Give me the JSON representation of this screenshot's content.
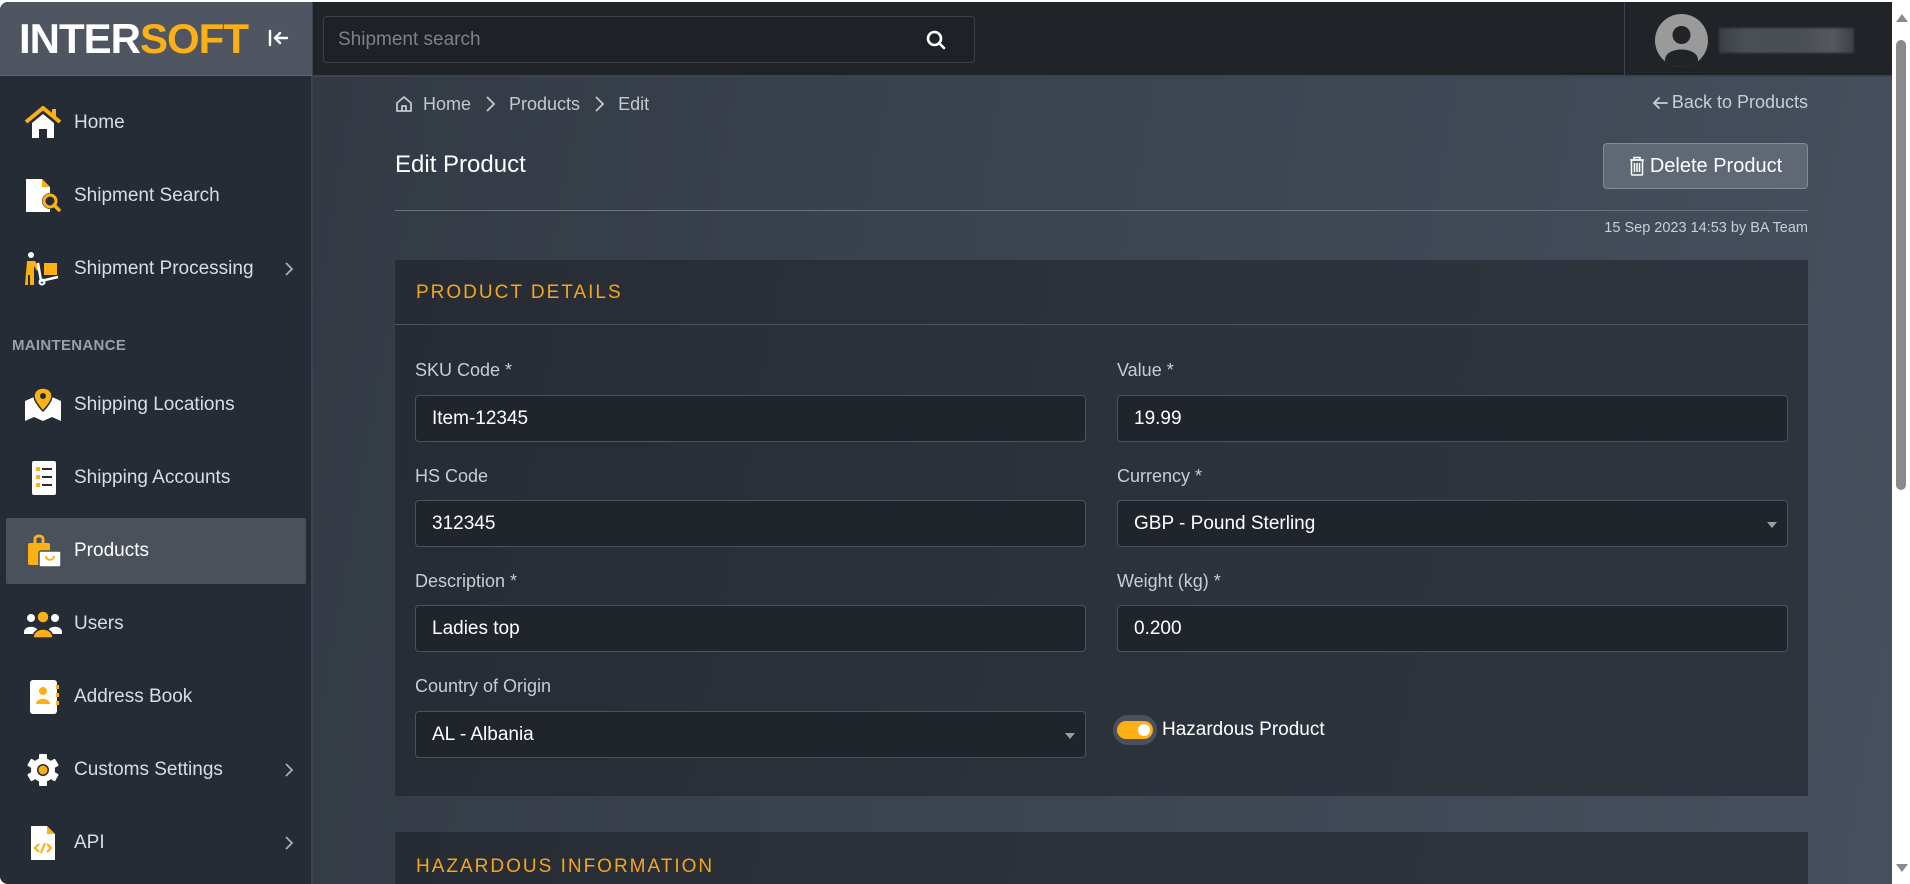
{
  "brand": {
    "logo_part1": "INTER",
    "logo_part2": "SOFT",
    "accent_color": "#fbb116",
    "collapse_icon": "collapse-sidebar-icon"
  },
  "topbar": {
    "search_placeholder": "Shipment search",
    "search_value": "",
    "search_icon": "search-icon",
    "avatar_icon": "user-avatar-icon"
  },
  "sidebar": {
    "items": [
      {
        "label": "Home",
        "icon": "home-icon",
        "has_submenu": false,
        "active": false
      },
      {
        "label": "Shipment Search",
        "icon": "document-search-icon",
        "has_submenu": false,
        "active": false
      },
      {
        "label": "Shipment Processing",
        "icon": "hand-truck-icon",
        "has_submenu": true,
        "active": false
      }
    ],
    "section_label": "MAINTENANCE",
    "maintenance_items": [
      {
        "label": "Shipping Locations",
        "icon": "map-pin-icon",
        "has_submenu": false,
        "active": false
      },
      {
        "label": "Shipping Accounts",
        "icon": "list-icon",
        "has_submenu": false,
        "active": false
      },
      {
        "label": "Products",
        "icon": "shopping-bag-icon",
        "has_submenu": false,
        "active": true
      },
      {
        "label": "Users",
        "icon": "users-icon",
        "has_submenu": false,
        "active": false
      },
      {
        "label": "Address Book",
        "icon": "address-book-icon",
        "has_submenu": false,
        "active": false
      },
      {
        "label": "Customs Settings",
        "icon": "gear-icon",
        "has_submenu": true,
        "active": false
      },
      {
        "label": "API",
        "icon": "code-file-icon",
        "has_submenu": true,
        "active": false
      }
    ]
  },
  "breadcrumb": {
    "items": [
      "Home",
      "Products",
      "Edit"
    ]
  },
  "page": {
    "back_link": "Back to Products",
    "title": "Edit Product",
    "delete_label": "Delete Product",
    "timestamp": "15 Sep 2023 14:53 by BA Team"
  },
  "product_details": {
    "section_title": "PRODUCT DETAILS",
    "sku": {
      "label": "SKU Code *",
      "value": "Item-12345"
    },
    "value": {
      "label": "Value *",
      "value": "19.99"
    },
    "hs_code": {
      "label": "HS Code",
      "value": "312345"
    },
    "currency": {
      "label": "Currency *",
      "value": "GBP - Pound Sterling"
    },
    "description": {
      "label": "Description *",
      "value": "Ladies top"
    },
    "weight": {
      "label": "Weight (kg) *",
      "value": "0.200"
    },
    "country": {
      "label": "Country of Origin",
      "value": "AL - Albania"
    },
    "hazardous": {
      "label": "Hazardous Product",
      "checked": true
    }
  },
  "hazardous_info": {
    "section_title": "HAZARDOUS INFORMATION"
  }
}
